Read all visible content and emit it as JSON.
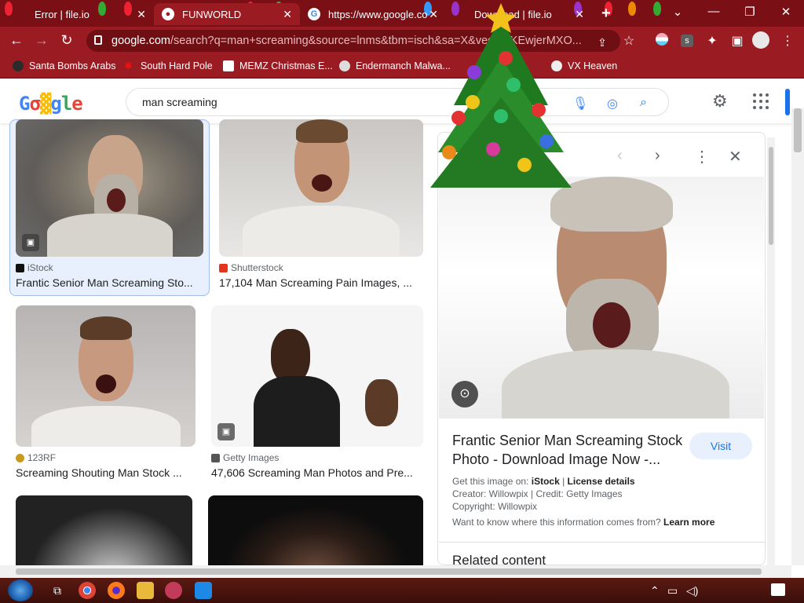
{
  "browser": {
    "tabs": [
      {
        "title": "Error | file.io",
        "active": false
      },
      {
        "title": "FUNWORLD",
        "active": true
      },
      {
        "title": "https://www.google.co",
        "active": false
      },
      {
        "title": "Download | file.io",
        "active": false
      }
    ],
    "new_tab_label": "+",
    "url_host": "google.com",
    "url_rest": "/search?q=man+screaming&source=lnms&tbm=isch&sa=X&ved=...KEwjerMXO...",
    "bookmarks": [
      {
        "label": "Santa Bombs Arabs"
      },
      {
        "label": "South Hard Pole"
      },
      {
        "label": "MEMZ Christmas E..."
      },
      {
        "label": "Endermanch Malwa..."
      },
      {
        "label": "VX Heaven"
      }
    ]
  },
  "google": {
    "logo_text": "Google",
    "search_query": "man screaming"
  },
  "results": [
    {
      "source": "iStock",
      "title": "Frantic Senior Man Screaming Sto..."
    },
    {
      "source": "Shutterstock",
      "title": "17,104 Man Screaming Pain Images, ..."
    },
    {
      "source": "123RF",
      "title": "Screaming Shouting Man Stock ..."
    },
    {
      "source": "Getty Images",
      "title": "47,606 Screaming Man Photos and Pre..."
    }
  ],
  "panel": {
    "title": "Frantic Senior Man Screaming Stock Photo - Download Image Now -...",
    "visit_label": "Visit",
    "get_image_prefix": "Get this image on:",
    "get_image_source": "iStock",
    "license_label": "License details",
    "creator_line": "Creator: Willowpix | Credit: Getty Images",
    "copyright_line": "Copyright: Willowpix",
    "info_question": "Want to know where this information comes from?",
    "learn_more": "Learn more",
    "related_heading": "Related content"
  },
  "colors": {
    "chrome_dark": "#7a0f16",
    "chrome": "#9b1b22",
    "google_blue": "#1a73e8"
  }
}
